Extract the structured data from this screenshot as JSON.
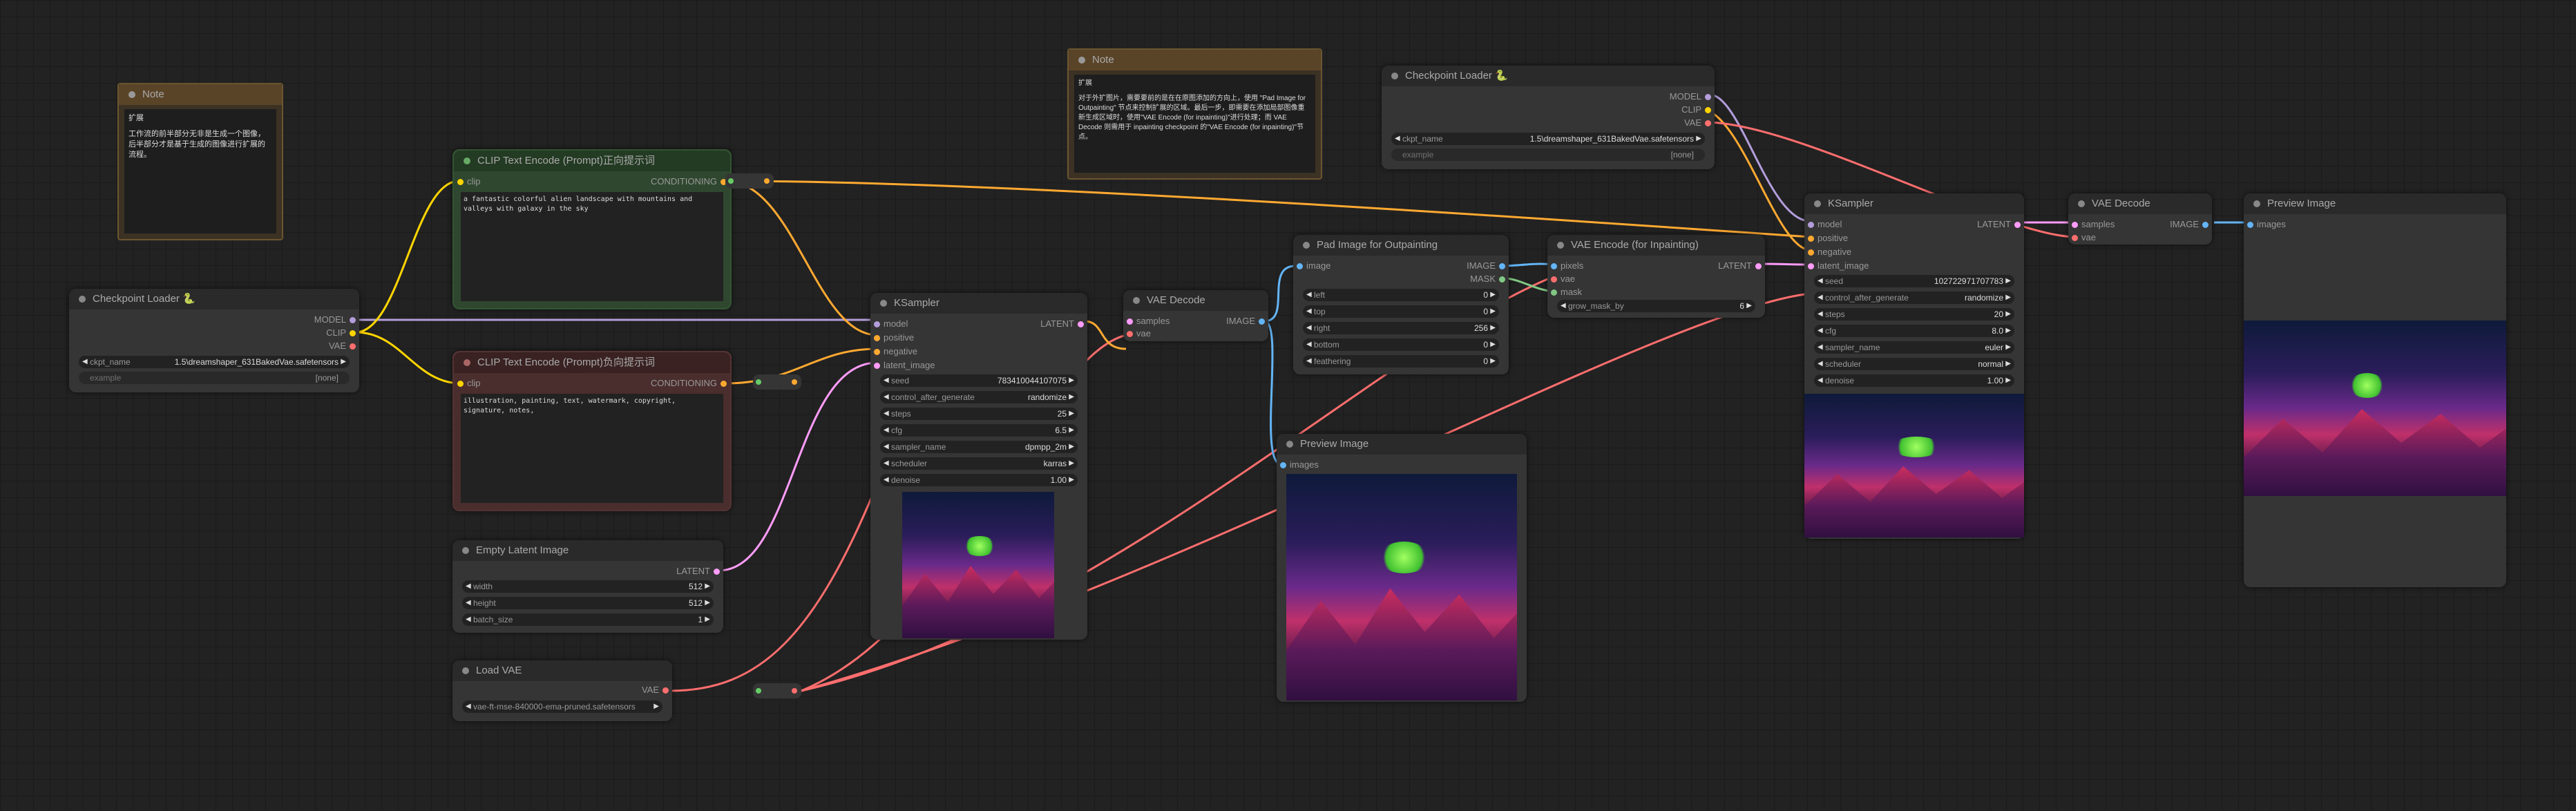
{
  "colors": {
    "model": "#b39ddb",
    "clip": "#ffd500",
    "vae": "#ff6e6e",
    "conditioning": "#ffa931",
    "latent": "#ff9cf9",
    "image": "#64b5f6",
    "mask": "#81c784",
    "int": "#29699c"
  },
  "note1": {
    "title": "Note",
    "heading": "扩展",
    "text": "工作流的前半部分无非是生成一个图像，后半部分才是基于生成的图像进行扩展的流程。"
  },
  "note2": {
    "title": "Note",
    "heading": "扩展",
    "text": "对于外扩图片，需要要前的是在在原图添加的方向上，使用 \"Pad Image for Outpainting\" 节点来控制扩展的区域。最后一步，即需要在添加局部图像重新生成区域时，使用\"VAE Encode (for inpainting)\"进行处理；而 VAE Decode 则需用于 inpainting checkpoint 的\"VAE Encode (for inpainting)\"节点。"
  },
  "ckpt1": {
    "title": "Checkpoint Loader 🐍",
    "outputs": [
      "MODEL",
      "CLIP",
      "VAE"
    ],
    "ckpt_label": "ckpt_name",
    "ckpt_value": "1.5\\dreamshaper_631BakedVae.safetensors",
    "example_label": "example",
    "example_value": "[none]"
  },
  "ckpt2": {
    "title": "Checkpoint Loader 🐍",
    "outputs": [
      "MODEL",
      "CLIP",
      "VAE"
    ],
    "ckpt_label": "ckpt_name",
    "ckpt_value": "1.5\\dreamshaper_631BakedVae.safetensors",
    "example_label": "example",
    "example_value": "[none]"
  },
  "clip_pos": {
    "title": "CLIP Text Encode (Prompt)正向提示词",
    "in": "clip",
    "out": "CONDITIONING",
    "text": "a fantastic colorful alien landscape with mountains and valleys with galaxy in the sky"
  },
  "clip_neg": {
    "title": "CLIP Text Encode (Prompt)负向提示词",
    "in": "clip",
    "out": "CONDITIONING",
    "text": "illustration, painting, text, watermark, copyright, signature, notes,"
  },
  "empty_latent": {
    "title": "Empty Latent Image",
    "out": "LATENT",
    "widgets": [
      {
        "label": "width",
        "value": "512"
      },
      {
        "label": "height",
        "value": "512"
      },
      {
        "label": "batch_size",
        "value": "1"
      }
    ]
  },
  "load_vae": {
    "title": "Load VAE",
    "out": "VAE",
    "vae_name": "vae-ft-mse-840000-ema-pruned.safetensors"
  },
  "ksampler1": {
    "title": "KSampler",
    "inputs": [
      "model",
      "positive",
      "negative",
      "latent_image"
    ],
    "out": "LATENT",
    "widgets": [
      {
        "label": "seed",
        "value": "783410044107075"
      },
      {
        "label": "control_after_generate",
        "value": "randomize"
      },
      {
        "label": "steps",
        "value": "25"
      },
      {
        "label": "cfg",
        "value": "6.5"
      },
      {
        "label": "sampler_name",
        "value": "dpmpp_2m"
      },
      {
        "label": "scheduler",
        "value": "karras"
      },
      {
        "label": "denoise",
        "value": "1.00"
      }
    ]
  },
  "vae_decode1": {
    "title": "VAE Decode",
    "inputs": [
      "samples",
      "vae"
    ],
    "out": "IMAGE"
  },
  "pad": {
    "title": "Pad Image for Outpainting",
    "in": "image",
    "outputs": [
      "IMAGE",
      "MASK"
    ],
    "widgets": [
      {
        "label": "left",
        "value": "0"
      },
      {
        "label": "top",
        "value": "0"
      },
      {
        "label": "right",
        "value": "256"
      },
      {
        "label": "bottom",
        "value": "0"
      },
      {
        "label": "feathering",
        "value": "0"
      }
    ]
  },
  "vae_encode_inp": {
    "title": "VAE Encode (for Inpainting)",
    "inputs": [
      "pixels",
      "vae",
      "mask"
    ],
    "out": "LATENT",
    "widgets": [
      {
        "label": "grow_mask_by",
        "value": "6"
      }
    ]
  },
  "preview1": {
    "title": "Preview Image",
    "in": "images"
  },
  "ksampler2": {
    "title": "KSampler",
    "inputs": [
      "model",
      "positive",
      "negative",
      "latent_image"
    ],
    "out": "LATENT",
    "widgets": [
      {
        "label": "seed",
        "value": "102722971707783"
      },
      {
        "label": "control_after_generate",
        "value": "randomize"
      },
      {
        "label": "steps",
        "value": "20"
      },
      {
        "label": "cfg",
        "value": "8.0"
      },
      {
        "label": "sampler_name",
        "value": "euler"
      },
      {
        "label": "scheduler",
        "value": "normal"
      },
      {
        "label": "denoise",
        "value": "1.00"
      }
    ]
  },
  "vae_decode2": {
    "title": "VAE Decode",
    "inputs": [
      "samples",
      "vae"
    ],
    "out": "IMAGE"
  },
  "preview2": {
    "title": "Preview Image",
    "in": "images"
  }
}
